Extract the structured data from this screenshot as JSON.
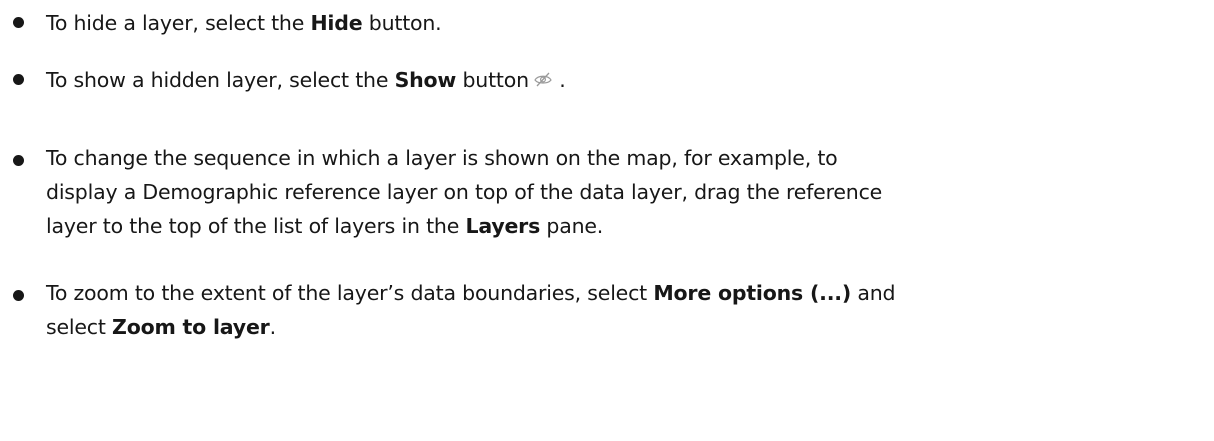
{
  "items": [
    {
      "pre": "To hide a layer, select the ",
      "bold": "Hide",
      "post": " button."
    },
    {
      "pre": "To show a hidden layer, select the ",
      "bold": "Show",
      "post": " button",
      "icon": "eye-slash-icon",
      "tail": " ."
    },
    {
      "line1": "To change the sequence in which a layer is shown on the map, for example, to",
      "line2": "display a Demographic reference layer on top of the data layer, drag the reference",
      "line3_pre": "layer to the top of the list of layers in the ",
      "line3_bold": "Layers",
      "line3_post": " pane."
    },
    {
      "line1_pre": "To zoom to the extent of the layer’s data boundaries, select ",
      "line1_bold": "More options (...)",
      "line1_post": " and",
      "line2_pre": "select ",
      "line2_bold": "Zoom to layer",
      "line2_post": "."
    }
  ]
}
